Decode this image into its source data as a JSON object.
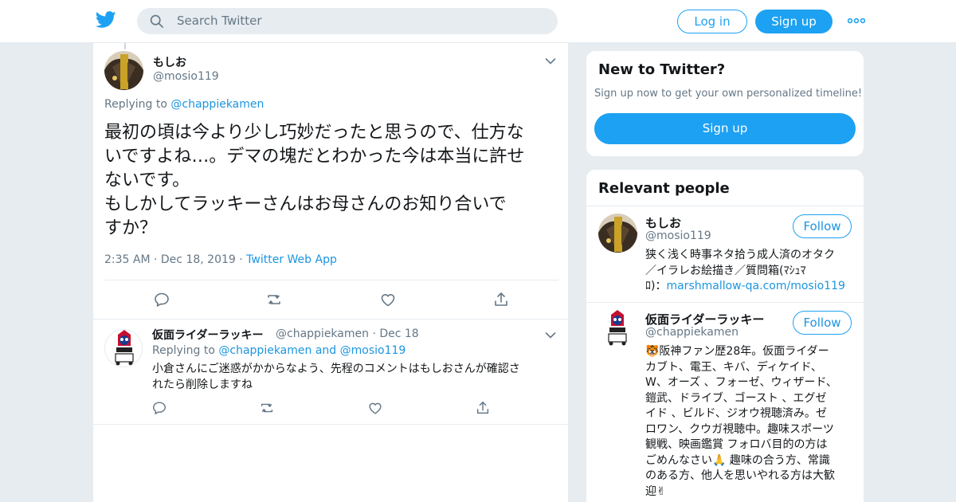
{
  "header": {
    "search_placeholder": "Search Twitter",
    "login_label": "Log in",
    "signup_label": "Sign up",
    "more_icon": "more-horizontal-icon",
    "brand_color": "#1da1f2"
  },
  "tweet": {
    "name": "もしお",
    "handle": "@mosio119",
    "replying_prefix": "Replying to",
    "replying_to": "@chappiekamen",
    "text": "最初の頃は今より少し巧妙だったと思うので、仕方な\nいですよね…。デマの塊だとわかった今は本当に許せ\nないです。\nもしかしてラッキーさんはお母さんのお知り合いで\nすか？",
    "time": "2:35 AM",
    "date": "Dec 18, 2019",
    "source": "Twitter Web App",
    "sep": "·"
  },
  "reply": {
    "name": "仮面ライダーラッキー",
    "handle": "@chappiekamen",
    "sep": "·",
    "date": "Dec 18",
    "replying_prefix": "Replying to",
    "replying_to_1": "@chappiekamen",
    "and": "and",
    "replying_to_2": "@mosio119",
    "text": "小倉さんにご迷惑がかからなよう、先程のコメントはもしおさんが確認さ\nれたら削除しますね"
  },
  "new_to_twitter": {
    "title": "New to Twitter?",
    "subtitle": "Sign up now to get your own personalized timeline!",
    "button": "Sign up"
  },
  "relevant_people": {
    "title": "Relevant people",
    "people": [
      {
        "name": "もしお",
        "handle": "@mosio119",
        "follow": "Follow",
        "bio_text": "狭く浅く時事ネタ拾う成人済のオタク\n／イラレお絵描き／質問箱(ﾏｼｭﾏ\nﾛ)：",
        "bio_link": "marshmallow-qa.com/mosio119"
      },
      {
        "name": "仮面ライダーラッキー",
        "handle": "@chappiekamen",
        "follow": "Follow",
        "bio_text": "🐯阪神ファン歴28年。仮面ライダー\nカブト、電王、キバ、ディケイド、\nW、オーズ 、フォーゼ、ウィザード、\n鎧武、ドライブ、ゴースト 、エグゼ\nイド 、ビルド、ジオウ視聴済み。ゼ\nロワン、クウガ視聴中。趣味スポーツ\n観戦、映画鑑賞 フォロバ目的の方は\nごめんなさい🙏 趣味の合う方、常識\nのある方、他人を思いやれる方は大歓\n迎✌"
      }
    ]
  }
}
